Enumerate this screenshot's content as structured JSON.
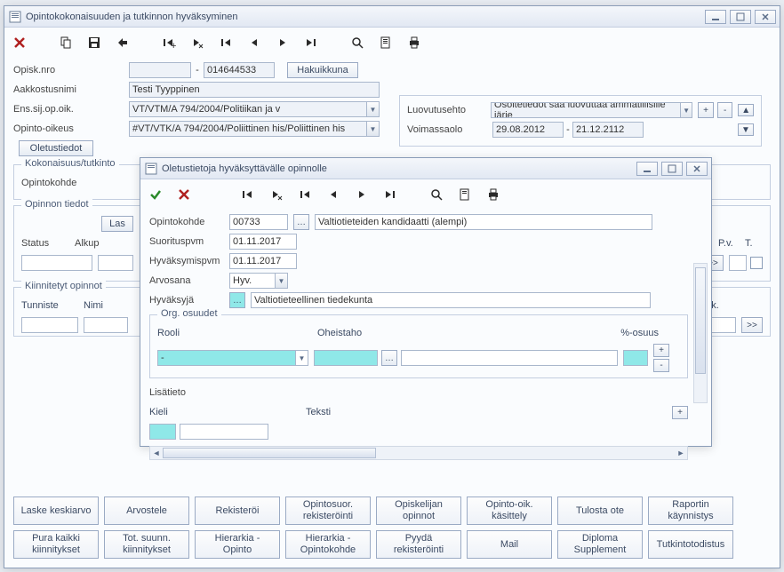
{
  "mainWindow": {
    "title": "Opintokokonaisuuden ja tutkinnon hyväksyminen"
  },
  "form": {
    "opiskNro_label": "Opisk.nro",
    "opiskNro_part1": "",
    "opiskNro_sep": "-",
    "opiskNro_part2": "014644533",
    "hakuikkuna_btn": "Hakuikkuna",
    "aakkostusnimi_label": "Aakkostusnimi",
    "aakkostusnimi_value": "Testi Tyyppinen",
    "ensSijOpOik_label": "Ens.sij.op.oik.",
    "ensSijOpOik_value": "VT/VTM/A 794/2004/Politiikan ja v",
    "opintoOikeus_label": "Opinto-oikeus",
    "opintoOikeus_value": "#VT/VTK/A 794/2004/Poliittinen his/Poliittinen his",
    "oletustiedot_btn": "Oletustiedot",
    "luovutusehto_label": "Luovutusehto",
    "luovutusehto_value": "Osoitetiedot saa luovuttaa ammatillisille järje",
    "voimassaolo_label": "Voimassaolo",
    "voimassaolo_from": "29.08.2012",
    "voimassaolo_sep": "-",
    "voimassaolo_to": "21.12.2112"
  },
  "kokonaisuus": {
    "legend": "Kokonaisuus/tutkinto",
    "opintokohde_label": "Opintokohde"
  },
  "opinnonTiedot": {
    "legend": "Opinnon tiedot",
    "las_btn": "Las",
    "status_label": "Status",
    "alkup_label": "Alkup",
    "pv_label": "P.v.",
    "t_label": "T.",
    "nav_btn": ">>"
  },
  "kiinnitetyt": {
    "legend": "Kiinnitetyt opinnot",
    "tunniste_label": "Tunniste",
    "nimi_label": "Nimi",
    "nok_label": "nok.",
    "nav_btn": ">>"
  },
  "modal": {
    "title": "Oletustietoja hyväksyttävälle opinnolle",
    "opintokohde_label": "Opintokohde",
    "opintokohde_code": "00733",
    "opintokohde_name": "Valtiotieteiden kandidaatti (alempi)",
    "suorituspvm_label": "Suorituspvm",
    "suorituspvm_value": "01.11.2017",
    "hyvaksymispvm_label": "Hyväksymispvm",
    "hyvaksymispvm_value": "01.11.2017",
    "arvosana_label": "Arvosana",
    "arvosana_value": "Hyv.",
    "hyvaksyja_label": "Hyväksyjä",
    "hyvaksyja_value": "Valtiotieteellinen tiedekunta",
    "orgOsuudet_legend": "Org. osuudet",
    "rooli_label": "Rooli",
    "rooli_value": "-",
    "oheistaho_label": "Oheistaho",
    "prosOsuus_label": "%-osuus",
    "lisatieto_label": "Lisätieto",
    "kieli_label": "Kieli",
    "teksti_label": "Teksti"
  },
  "bottomButtons": {
    "row1": [
      "Laske keskiarvo",
      "Arvostele",
      "Rekisteröi",
      "Opintosuor. rekisteröinti",
      "Opiskelijan opinnot",
      "Opinto-oik. käsittely",
      "Tulosta ote",
      "Raportin käynnistys"
    ],
    "row2": [
      "Pura kaikki kiinnitykset",
      "Tot. suunn. kiinnitykset",
      "Hierarkia - Opinto",
      "Hierarkia - Opintokohde",
      "Pyydä rekisteröinti",
      "Mail",
      "Diploma Supplement",
      "Tutkintotodistus"
    ]
  }
}
